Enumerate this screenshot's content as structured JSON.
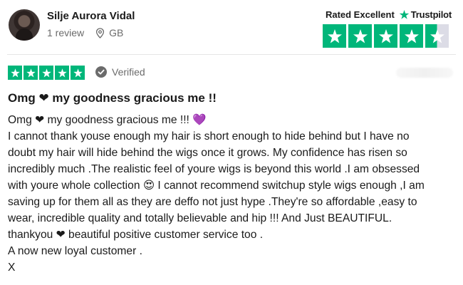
{
  "reviewer": {
    "name": "Silje Aurora Vidal",
    "review_count": "1 review",
    "location": "GB",
    "avatar_icon": "avatar-photo",
    "location_icon": "location-pin-icon"
  },
  "rating_badge": {
    "label": "Rated Excellent",
    "brand": "Trustpilot",
    "rating": 4.5,
    "max": 5,
    "color": "#00b67a"
  },
  "review": {
    "stars": 5,
    "verified_label": "Verified",
    "title": "Omg ❤ my goodness gracious me !!",
    "body_lines": [
      "Omg ❤ my goodness gracious me !!! 💜",
      "I cannot thank youse enough my hair is short enough to hide behind but I have no",
      "doubt my hair will hide behind the wigs once it grows. My confidence has risen so",
      "incredibly much .The realistic feel of youre wigs is beyond this world .I am obsessed",
      "with youre whole collection 😍 I cannot recommend switchup style wigs enough ,I am",
      "saving up for them all as they are deffo not just hype .They're so affordable ,easy to",
      "wear, incredible quality and totally believable and hip !!! And Just BEAUTIFUL.",
      "thankyou ❤ beautiful positive customer service too .",
      "A now new loyal customer .",
      "X"
    ]
  }
}
